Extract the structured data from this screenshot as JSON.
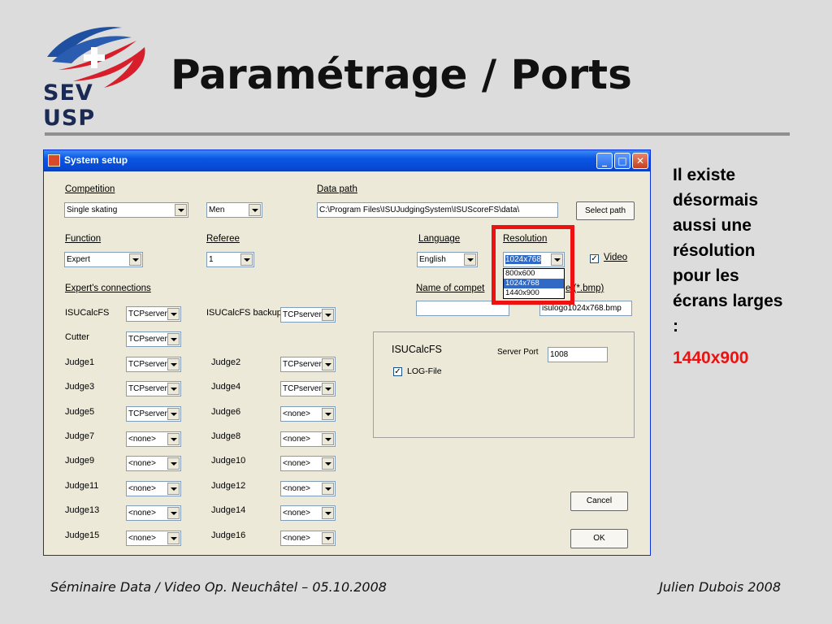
{
  "slide": {
    "logo_text_1": "SEV",
    "logo_text_2": "USP",
    "title": "Paramétrage / Ports",
    "side_text": "Il existe désormais aussi une résolution pour les écrans larges :",
    "side_highlight": "1440x900",
    "footer_left": "Séminaire Data / Video Op. Neuchâtel – 05.10.2008",
    "footer_right": "Julien Dubois 2008"
  },
  "window": {
    "title": "System setup",
    "minimize_glyph": "_",
    "maximize_glyph": "□",
    "close_glyph": "✕"
  },
  "form": {
    "competition": {
      "label": "Competition",
      "value": "Single skating",
      "category": "Men"
    },
    "data_path": {
      "label": "Data path",
      "value": "C:\\Program Files\\ISUJudgingSystem\\ISUScoreFS\\data\\",
      "button": "Select path"
    },
    "function": {
      "label": "Function",
      "value": "Expert"
    },
    "referee": {
      "label": "Referee",
      "value": "1"
    },
    "language": {
      "label": "Language",
      "value": "English"
    },
    "resolution": {
      "label": "Resolution",
      "value": "1024x768",
      "options": [
        "800x600",
        "1024x768",
        "1440x900"
      ]
    },
    "video": {
      "label": "Video",
      "checked": true
    },
    "experts_label": "Expert's connections",
    "name_label_visible": "Name of compet",
    "logo_label_visible": "e (*.bmp)",
    "name_value": "",
    "logo_value": "isulogo1024x768.bmp",
    "connections": {
      "isucalcfs": {
        "label": "ISUCalcFS",
        "value": "TCPserver"
      },
      "isucalcfs_backup": {
        "label": "ISUCalcFS backup",
        "value": "TCPserver"
      },
      "cutter": {
        "label": "Cutter",
        "value": "TCPserver"
      },
      "judge1": {
        "label": "Judge1",
        "value": "TCPserver"
      },
      "judge2": {
        "label": "Judge2",
        "value": "TCPserver"
      },
      "judge3": {
        "label": "Judge3",
        "value": "TCPserver"
      },
      "judge4": {
        "label": "Judge4",
        "value": "TCPserver"
      },
      "judge5": {
        "label": "Judge5",
        "value": "TCPserver"
      },
      "judge6": {
        "label": "Judge6",
        "value": "<none>"
      },
      "judge7": {
        "label": "Judge7",
        "value": "<none>"
      },
      "judge8": {
        "label": "Judge8",
        "value": "<none>"
      },
      "judge9": {
        "label": "Judge9",
        "value": "<none>"
      },
      "judge10": {
        "label": "Judge10",
        "value": "<none>"
      },
      "judge11": {
        "label": "Judge11",
        "value": "<none>"
      },
      "judge12": {
        "label": "Judge12",
        "value": "<none>"
      },
      "judge13": {
        "label": "Judge13",
        "value": "<none>"
      },
      "judge14": {
        "label": "Judge14",
        "value": "<none>"
      },
      "judge15": {
        "label": "Judge15",
        "value": "<none>"
      },
      "judge16": {
        "label": "Judge16",
        "value": "<none>"
      }
    },
    "panel": {
      "title": "ISUCalcFS",
      "server_port_label": "Server Port",
      "server_port_value": "1008",
      "log_file_label": "LOG-File",
      "log_file_checked": true
    },
    "cancel_button": "Cancel",
    "ok_button": "OK",
    "check_glyph": "✓"
  }
}
